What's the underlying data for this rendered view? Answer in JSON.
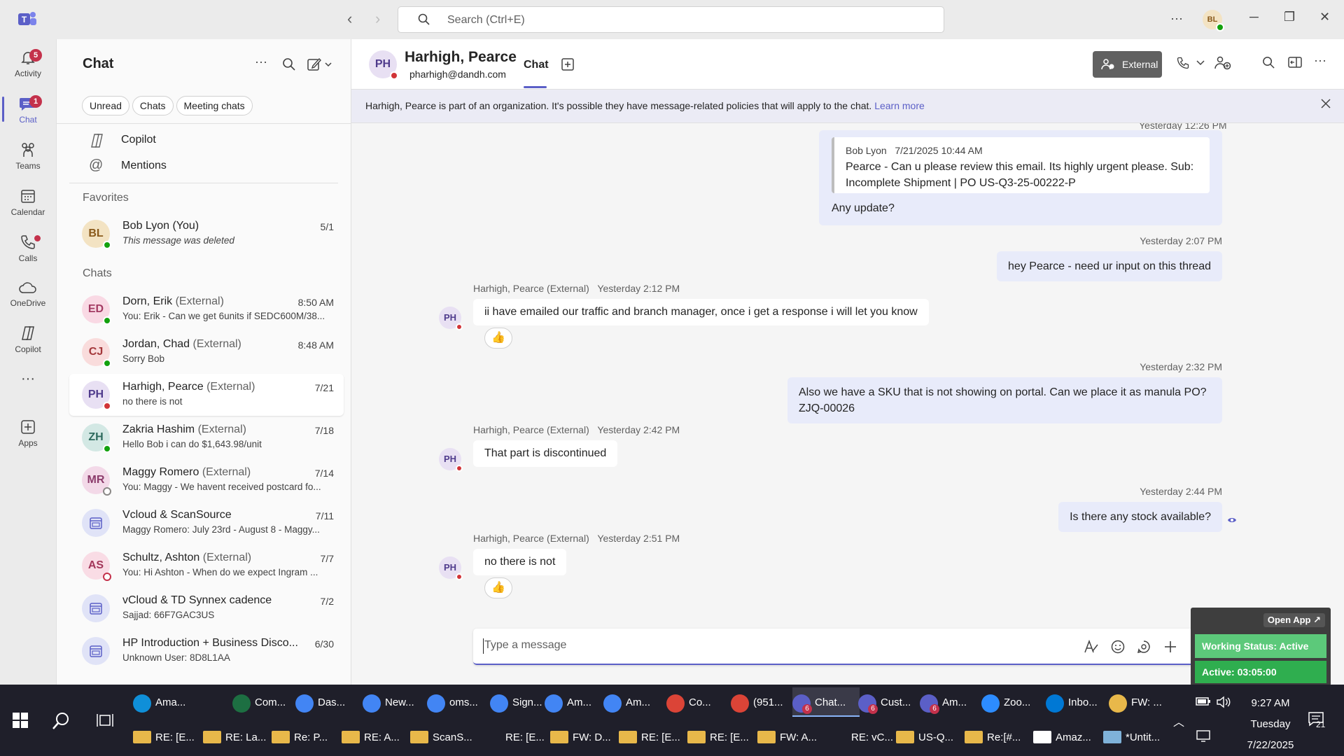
{
  "titlebar": {
    "search_placeholder": "Search (Ctrl+E)",
    "avatar_initials": "BL"
  },
  "rail": [
    {
      "label": "Activity",
      "badge": "5"
    },
    {
      "label": "Chat",
      "badge": "1"
    },
    {
      "label": "Teams",
      "badge": ""
    },
    {
      "label": "Calendar",
      "badge": ""
    },
    {
      "label": "Calls",
      "badge": ""
    },
    {
      "label": "OneDrive",
      "badge": ""
    },
    {
      "label": "Copilot",
      "badge": ""
    },
    {
      "label": "",
      "badge": ""
    },
    {
      "label": "Apps",
      "badge": ""
    }
  ],
  "listpane": {
    "title": "Chat",
    "filters": [
      "Unread",
      "Chats",
      "Meeting chats"
    ],
    "shortcuts": [
      "Copilot",
      "Mentions"
    ],
    "favorites_label": "Favorites",
    "chats_label": "Chats",
    "favorites": [
      {
        "initials": "BL",
        "name": "Bob Lyon (You)",
        "ext": "",
        "preview": "This message was deleted",
        "time": "5/1"
      }
    ],
    "chats": [
      {
        "initials": "ED",
        "name": "Dorn, Erik",
        "ext": "(External)",
        "preview": "You: Erik -  Can we get 6units if SEDC600M/38...",
        "time": "8:50 AM"
      },
      {
        "initials": "CJ",
        "name": "Jordan, Chad",
        "ext": "(External)",
        "preview": "Sorry Bob",
        "time": "8:48 AM"
      },
      {
        "initials": "PH",
        "name": "Harhigh, Pearce",
        "ext": "(External)",
        "preview": "no there is not",
        "time": "7/21"
      },
      {
        "initials": "ZH",
        "name": "Zakria Hashim",
        "ext": "(External)",
        "preview": "Hello Bob i can do $1,643.98/unit",
        "time": "7/18"
      },
      {
        "initials": "MR",
        "name": "Maggy Romero",
        "ext": "(External)",
        "preview": "You: Maggy - We havent received postcard fo...",
        "time": "7/14"
      },
      {
        "initials": "",
        "name": "Vcloud & ScanSource",
        "ext": "",
        "preview": "Maggy Romero: July 23rd - August 8 - Maggy...",
        "time": "7/11"
      },
      {
        "initials": "AS",
        "name": "Schultz, Ashton",
        "ext": "(External)",
        "preview": "You: Hi Ashton -  When do we expect Ingram ...",
        "time": "7/7"
      },
      {
        "initials": "",
        "name": "vCloud & TD Synnex cadence",
        "ext": "",
        "preview": "Sajjad: 66F7GAC3US",
        "time": "7/2"
      },
      {
        "initials": "",
        "name": "HP Introduction + Business Disco...",
        "ext": "",
        "preview": "Unknown User: 8D8L1AA",
        "time": "6/30"
      }
    ]
  },
  "conversation": {
    "initials": "PH",
    "name": "Harhigh, Pearce",
    "email": "pharhigh@dandh.com",
    "tab": "Chat",
    "external_label": "External",
    "banner_text": "Harhigh, Pearce is part of an organization. It's possible they have message-related policies that will apply to the chat.",
    "banner_link": "Learn more",
    "top_timestamp": "Yesterday 12:26 PM",
    "quote_author": "Bob Lyon",
    "quote_time": "7/21/2025 10:44 AM",
    "quote_text": "Pearce - Can u please review this email. Its highly urgent please. Sub: Incomplete Shipment | PO US-Q3-25-00222-P",
    "quote_reply": "Any update?",
    "messages": [
      {
        "time": "Yesterday 2:07 PM",
        "text": "hey Pearce -  need ur input on this thread"
      },
      {
        "sender": "Harhigh, Pearce (External)",
        "time": "Yesterday 2:12 PM",
        "text": "ii have emailed our traffic and branch manager, once i get a response i will let you know",
        "reaction": "👍"
      },
      {
        "time": "Yesterday 2:32 PM",
        "text": "Also we have a SKU that is not showing on portal. Can we place it as manula PO? ZJQ-00026"
      },
      {
        "sender": "Harhigh, Pearce (External)",
        "time": "Yesterday 2:42 PM",
        "text": "That part is discontinued"
      },
      {
        "time": "Yesterday 2:44 PM",
        "text": "Is there any stock available?"
      },
      {
        "sender": "Harhigh, Pearce (External)",
        "time": "Yesterday 2:51 PM",
        "text": "no there is not",
        "reaction": "👍"
      }
    ],
    "composer_placeholder": "Type a message"
  },
  "widget": {
    "open_app": "Open App ↗",
    "status": "Working Status: Active",
    "active": "Active: 03:05:00"
  },
  "taskbar": {
    "row1": [
      {
        "label": "Ama...",
        "color": "#0f8fd8",
        "num": ""
      },
      {
        "label": "Com...",
        "color": "#1d6f42",
        "num": ""
      },
      {
        "label": "Das...",
        "color": "#4285f4",
        "num": ""
      },
      {
        "label": "New...",
        "color": "#4285f4",
        "num": ""
      },
      {
        "label": "oms...",
        "color": "#4285f4",
        "num": ""
      },
      {
        "label": "Sign...",
        "color": "#4285f4",
        "num": ""
      },
      {
        "label": "Am...",
        "color": "#4285f4",
        "num": ""
      },
      {
        "label": "Am...",
        "color": "#4285f4",
        "num": ""
      },
      {
        "label": "Co...",
        "color": "#db4437",
        "num": ""
      },
      {
        "label": "(951...",
        "color": "#db4437",
        "num": ""
      },
      {
        "label": "Chat...",
        "color": "#5b5fc7",
        "num": "6"
      },
      {
        "label": "Cust...",
        "color": "#5b5fc7",
        "num": "6"
      },
      {
        "label": "Am...",
        "color": "#5b5fc7",
        "num": "6"
      },
      {
        "label": "Zoo...",
        "color": "#2d8cff",
        "num": ""
      },
      {
        "label": "Inbo...",
        "color": "#0078d4",
        "num": ""
      },
      {
        "label": "FW: ...",
        "color": "#e8b84a",
        "num": ""
      }
    ],
    "row2": [
      {
        "label": "RE: [E...",
        "color": "#e8b84a"
      },
      {
        "label": "RE: La...",
        "color": "#e8b84a"
      },
      {
        "label": "Re: P...",
        "color": "#e8b84a"
      },
      {
        "label": "RE: A...",
        "color": "#e8b84a"
      },
      {
        "label": "ScanS...",
        "color": "#e8b84a"
      },
      {
        "label": "RE: [E...",
        "color": ""
      },
      {
        "label": "FW: D...",
        "color": "#e8b84a"
      },
      {
        "label": "RE: [E...",
        "color": "#e8b84a"
      },
      {
        "label": "RE: [E...",
        "color": "#e8b84a"
      },
      {
        "label": "FW: A...",
        "color": "#e8b84a"
      },
      {
        "label": "RE: vC...",
        "color": ""
      },
      {
        "label": "US-Q...",
        "color": "#e8b84a"
      },
      {
        "label": "Re:[#...",
        "color": "#e8b84a"
      },
      {
        "label": "Amaz...",
        "color": "#ffffff"
      },
      {
        "label": "*Untit...",
        "color": "#7fb2d9"
      }
    ],
    "time": "9:27 AM",
    "day": "Tuesday",
    "date": "7/22/2025",
    "notif_count": "21"
  }
}
